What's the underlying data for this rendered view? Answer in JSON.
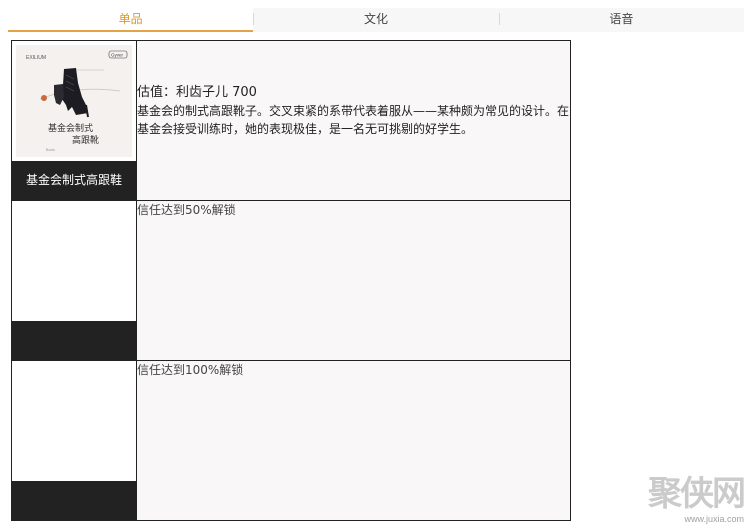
{
  "tabs": [
    {
      "label": "单品",
      "active": true
    },
    {
      "label": "文化",
      "active": false
    },
    {
      "label": "语音",
      "active": false
    }
  ],
  "items": [
    {
      "name": "基金会制式高跟鞋",
      "image_text": "基金会制式\n高跟靴",
      "price_line": "估值：利齿子儿 700",
      "description": "基金会的制式高跟靴子。交叉束紧的系带代表着服从——某种颇为常见的设计。在基金会接受训练时，她的表现极佳，是一名无可挑剔的好学生。"
    },
    {
      "locked_text": "信任达到50%解锁"
    },
    {
      "locked_text": "信任达到100%解锁"
    }
  ],
  "watermark": {
    "main": "聚侠网",
    "url": "www.juxia.com"
  },
  "colors": {
    "accent": "#e2a447",
    "dark_bar": "#222222",
    "desc_bg": "#faf7f8"
  }
}
